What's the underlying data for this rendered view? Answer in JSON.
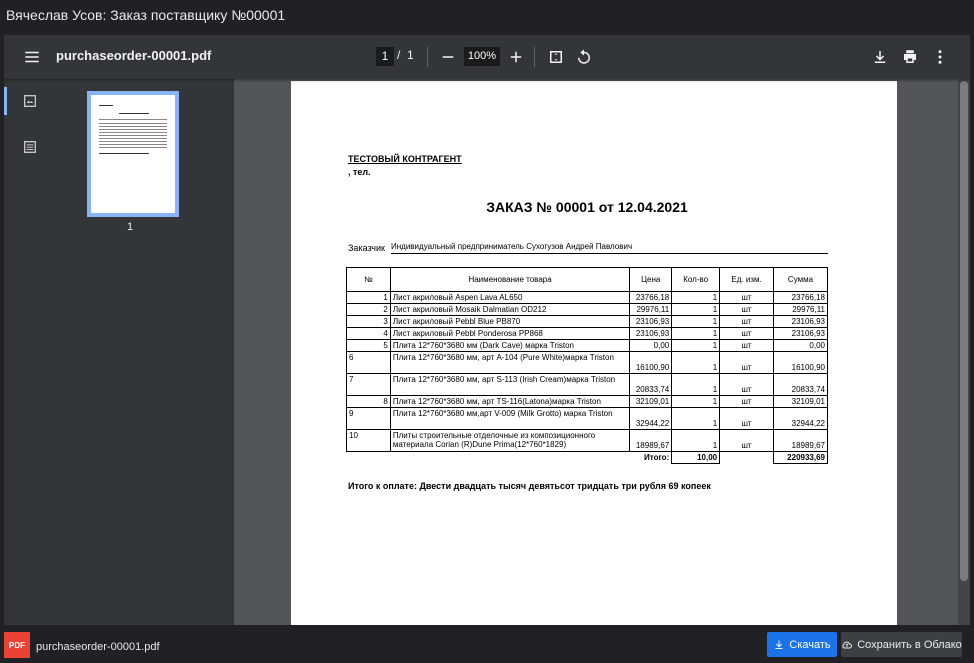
{
  "window": {
    "title": "Вячеслав Усов: Заказ поставщику №00001"
  },
  "toolbar": {
    "filename": "purchaseorder-00001.pdf",
    "current_page": "1",
    "page_separator": "/",
    "total_pages": "1",
    "zoom": "100%"
  },
  "sidebar": {
    "thumbnail_page": "1"
  },
  "document": {
    "counterparty": "ТЕСТОВЫЙ КОНТРАГЕНТ",
    "phone": ", тел.",
    "title": "ЗАКАЗ № 00001 от 12.04.2021",
    "customer_label": "Заказчик",
    "customer_value": "Индивидуальный предприниматель Сухогузов Андрей Павлович",
    "table": {
      "headers": [
        "№",
        "Наименование товара",
        "Цена",
        "Кол-во",
        "Ед. изм.",
        "Сумма"
      ],
      "rows": [
        [
          "1",
          "Лист акриловый Aspen Lava AL650",
          "23766,18",
          "1",
          "шт",
          "23766,18"
        ],
        [
          "2",
          "Лист акриловый Mosaik Dalmatian OD212",
          "29976,11",
          "1",
          "шт",
          "29976,11"
        ],
        [
          "3",
          "Лист акриловый Pebbl Blue PB870",
          "23106,93",
          "1",
          "шт",
          "23106,93"
        ],
        [
          "4",
          "Лист акриловый Pebbl Ponderosa PP868",
          "23106,93",
          "1",
          "шт",
          "23106,93"
        ],
        [
          "5",
          "Плита 12*760*3680 мм (Dark Cave) марка Triston",
          "0,00",
          "1",
          "шт",
          "0,00"
        ],
        [
          "6",
          "Плита 12*760*3680 мм, арт A-104 (Pure White)марка Triston",
          "16100,90",
          "1",
          "шт",
          "16100,90"
        ],
        [
          "7",
          "Плита 12*760*3680 мм, арт S-113 (Irish Cream)марка Triston",
          "20833,74",
          "1",
          "шт",
          "20833,74"
        ],
        [
          "8",
          "Плита 12*760*3680 мм, арт TS-116(Latona)марка Triston",
          "32109,01",
          "1",
          "шт",
          "32109,01"
        ],
        [
          "9",
          "Плита 12*760*3680 мм,арт V-009 (Milk Grotto) марка Triston",
          "32944,22",
          "1",
          "шт",
          "32944,22"
        ],
        [
          "10",
          "Плиты строительные отделочные из композиционного материала Corian (R)Dune Prima(12*760*1829)",
          "18989,67",
          "1",
          "шт",
          "18989,67"
        ]
      ],
      "total_label": "Итого:",
      "total_qty": "10,00",
      "total_sum": "220933,69"
    },
    "payment_text": "Итого к оплате: Двести двадцать тысяч девятьсот тридцать три рубля 69 копеек"
  },
  "download_bar": {
    "file_icon_label": "PDF",
    "file_name": "purchaseorder-00001.pdf",
    "download_label": "Скачать",
    "save_cloud_label": "Сохранить в Облако"
  }
}
